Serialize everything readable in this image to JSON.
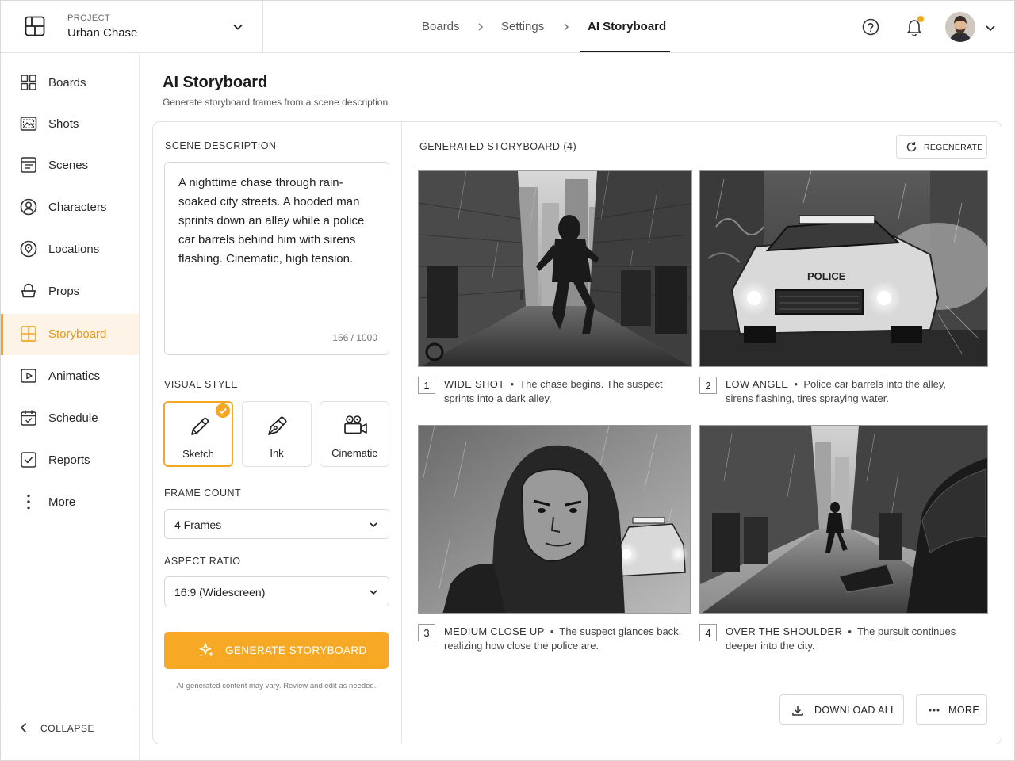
{
  "project": {
    "label": "PROJECT",
    "name": "Urban Chase"
  },
  "breadcrumbs": {
    "item1": "Boards",
    "item2": "Settings",
    "item3": "AI Storyboard"
  },
  "sidebar": {
    "items": [
      {
        "label": "Boards",
        "icon": "grid-icon"
      },
      {
        "label": "Shots",
        "icon": "image-icon"
      },
      {
        "label": "Scenes",
        "icon": "scenes-icon"
      },
      {
        "label": "Characters",
        "icon": "user-icon"
      },
      {
        "label": "Locations",
        "icon": "location-pin-icon"
      },
      {
        "label": "Props",
        "icon": "props-icon"
      },
      {
        "label": "Storyboard",
        "icon": "storyboard-icon"
      },
      {
        "label": "Animatics",
        "icon": "play-icon"
      },
      {
        "label": "Schedule",
        "icon": "calendar-icon"
      },
      {
        "label": "Reports",
        "icon": "checkbox-icon"
      },
      {
        "label": "More",
        "icon": "more-vertical-icon"
      }
    ],
    "active": "Storyboard",
    "collapse_label": "COLLAPSE"
  },
  "page": {
    "title": "AI Storyboard",
    "subtitle": "Generate storyboard frames from a scene description."
  },
  "scene": {
    "label": "SCENE DESCRIPTION",
    "text": "A nighttime chase through rain-soaked city streets. A hooded man sprints down an alley while a police car barrels behind him with sirens flashing. Cinematic, high tension.",
    "count": "156 / 1000"
  },
  "visual_style": {
    "label": "VISUAL STYLE",
    "options": [
      "Sketch",
      "Ink",
      "Cinematic"
    ],
    "selected": "Sketch"
  },
  "frame_count": {
    "label": "FRAME COUNT",
    "value": "4 Frames"
  },
  "aspect_ratio": {
    "label": "ASPECT RATIO",
    "value": "16:9 (Widescreen)"
  },
  "generate": {
    "label": "GENERATE STORYBOARD",
    "disclaimer": "AI-generated content may vary. Review and edit as needed."
  },
  "storyboard": {
    "title": "GENERATED STORYBOARD (4)",
    "regenerate_label": "REGENERATE",
    "frames": [
      {
        "num": "1",
        "shot": "WIDE SHOT",
        "desc": "The chase begins. The suspect sprints into a dark alley."
      },
      {
        "num": "2",
        "shot": "LOW ANGLE",
        "desc": "Police car barrels into the alley, sirens flashing, tires spraying water."
      },
      {
        "num": "3",
        "shot": "MEDIUM CLOSE UP",
        "desc": "The suspect glances back, realizing how close the police are."
      },
      {
        "num": "4",
        "shot": "OVER THE SHOULDER",
        "desc": "The pursuit continues deeper into the city."
      }
    ],
    "police_text": "POLICE"
  },
  "actions": {
    "download_label": "DOWNLOAD ALL",
    "more_label": "MORE"
  },
  "colors": {
    "accent": "#f5a623",
    "accent_bg": "#fdf3e6"
  }
}
